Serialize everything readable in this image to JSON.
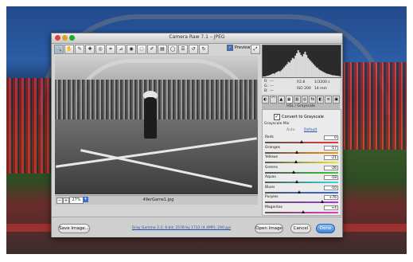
{
  "window": {
    "title": "Camera Raw 7.1 – JPEG",
    "preview_label": "Preview",
    "preview_checked": true
  },
  "toolbar": {
    "tools": [
      "zoom-icon",
      "hand-icon",
      "white-balance-icon",
      "color-sampler-icon",
      "target-adjust-icon",
      "crop-icon",
      "straighten-icon",
      "spot-removal-icon",
      "red-eye-icon",
      "adjustment-brush-icon",
      "graduated-filter-icon",
      "radial-filter-icon",
      "preferences-icon",
      "rotate-left-icon",
      "rotate-right-icon"
    ],
    "tool_glyphs": [
      "🔍",
      "✋",
      "✎",
      "✚",
      "◎",
      "⌗",
      "⊿",
      "◉",
      "◌",
      "✐",
      "▤",
      "◯",
      "☰",
      "↺",
      "↻"
    ]
  },
  "image": {
    "filename": "49erGame1.jpg",
    "zoom_value": "27%"
  },
  "histogram": {
    "bins": [
      2,
      2,
      3,
      4,
      5,
      6,
      8,
      10,
      9,
      12,
      14,
      16,
      15,
      18,
      22,
      26,
      30,
      34,
      40,
      38,
      44,
      50,
      48,
      56,
      62,
      70,
      64,
      58,
      54,
      60,
      66,
      58,
      50,
      46,
      42,
      38,
      34,
      30,
      26,
      24,
      20,
      18,
      16,
      14,
      12,
      10,
      9,
      8,
      7,
      6,
      5,
      5,
      4,
      4,
      3,
      3
    ]
  },
  "metadata": {
    "r": "R:",
    "g": "G:",
    "b": "B:",
    "r_val": "---",
    "g_val": "---",
    "b_val": "---",
    "aperture": "f/2.8",
    "shutter": "1/3200 s",
    "iso": "ISO 200",
    "focal": "14 mm"
  },
  "panel_tabs": [
    "basic-icon",
    "tone-curve-icon",
    "detail-icon",
    "hsl-icon",
    "split-toning-icon",
    "lens-icon",
    "effects-icon",
    "camera-calibration-icon",
    "presets-icon",
    "snapshots-icon"
  ],
  "panel_tab_glyphs": [
    "◐",
    "⌒",
    "▲",
    "▦",
    "▥",
    "◎",
    "fx",
    "◧",
    "≡",
    "▣"
  ],
  "panel": {
    "title": "HSL / Grayscale",
    "convert_label": "Convert to Grayscale",
    "convert_checked": true,
    "mix_label": "Grayscale Mix",
    "auto_label": "Auto",
    "default_label": "Default"
  },
  "sliders": [
    {
      "label": "Reds",
      "value": "0",
      "level": 0.5,
      "gradient": "#555,#e33"
    },
    {
      "label": "Oranges",
      "value": "-17",
      "level": 0.44,
      "gradient": "#555,#f90"
    },
    {
      "label": "Yellows",
      "value": "-21",
      "level": 0.42,
      "gradient": "#555,#ee2"
    },
    {
      "label": "Greens",
      "value": "-26",
      "level": 0.39,
      "gradient": "#555,#3c3"
    },
    {
      "label": "Aquas",
      "value": "-18",
      "level": 0.43,
      "gradient": "#555,#3dd"
    },
    {
      "label": "Blues",
      "value": "-10",
      "level": 0.47,
      "gradient": "#555,#36e"
    },
    {
      "label": "Purples",
      "value": "+76",
      "level": 0.78,
      "gradient": "#555,#a3e"
    },
    {
      "label": "Magentas",
      "value": "+4",
      "level": 0.52,
      "gradient": "#555,#e3c"
    }
  ],
  "footer": {
    "save_label": "Save Image...",
    "workflow_label": "Gray Gamma 2.2; 8 bit; 2578 by 1712 (4.4MP); 240 ppi",
    "open_label": "Open Image",
    "cancel_label": "Cancel",
    "done_label": "Done"
  },
  "colors": {
    "accent_blue": "#3c6fd0",
    "done_blue": "#3f83d8"
  }
}
